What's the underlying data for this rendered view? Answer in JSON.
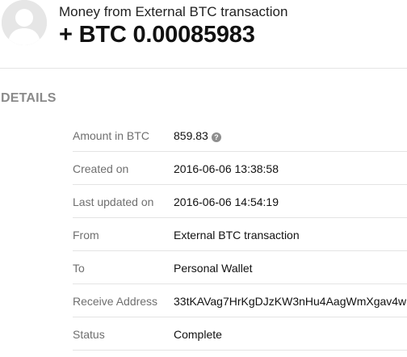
{
  "header": {
    "title": "Money from External BTC transaction",
    "amount": "+ BTC 0.00085983"
  },
  "details": {
    "heading": "DETAILS",
    "rows": [
      {
        "label": "Amount in BTC",
        "value": "859.83",
        "help_icon": "question-icon"
      },
      {
        "label": "Created on",
        "value": "2016-06-06 13:38:58"
      },
      {
        "label": "Last updated on",
        "value": "2016-06-06 14:54:19"
      },
      {
        "label": "From",
        "value": "External BTC transaction"
      },
      {
        "label": "To",
        "value": "Personal Wallet"
      },
      {
        "label": "Receive Address",
        "value": "33tKAVag7HrKgDJzKW3nHu4AagWmXgav4w"
      },
      {
        "label": "Status",
        "value": "Complete"
      }
    ]
  },
  "icons": {
    "avatar": "user-silhouette-icon",
    "help": "?"
  },
  "colors": {
    "label": "#6f6f6f",
    "heading": "#8a8a8a",
    "divider": "#e4e4e4",
    "avatar_bg": "#e6e6e6"
  }
}
